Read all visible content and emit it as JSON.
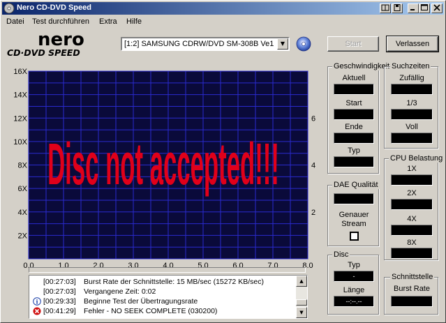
{
  "window": {
    "title": "Nero CD-DVD Speed",
    "controls": [
      "help",
      "save",
      "minimize",
      "maximize",
      "close"
    ]
  },
  "menu": [
    "Datei",
    "Test durchführen",
    "Extra",
    "Hilfe"
  ],
  "logo": {
    "line1": "nero",
    "line2": "CD·DVD SPEED"
  },
  "drive": {
    "selected": "[1:2]  SAMSUNG CDRW/DVD SM-308B Ve1"
  },
  "buttons": {
    "start": "Start",
    "exit": "Verlassen"
  },
  "chart_data": {
    "type": "line",
    "overlay_text": "Disc not accepted!!!",
    "x_ticks": [
      "0.0",
      "1.0",
      "2.0",
      "3.0",
      "4.0",
      "5.0",
      "6.0",
      "7.0",
      "8.0"
    ],
    "y_left_ticks": [
      "2X",
      "4X",
      "6X",
      "8X",
      "10X",
      "12X",
      "14X",
      "16X"
    ],
    "y_right_ticks": [
      "2",
      "4",
      "6"
    ],
    "xlim": [
      0,
      8
    ],
    "ylim_left": [
      0,
      16
    ],
    "ylim_right": [
      0,
      8
    ],
    "grid": true,
    "series": [],
    "colors": {
      "background": "#0a0a3a",
      "grid": "#2a2ad0",
      "overlay": "#e0001a"
    }
  },
  "log": [
    {
      "icon": "none",
      "time": "[00:27:03]",
      "message": "Burst Rate der Schnittstelle: 15 MB/sec (15272 KB/sec)"
    },
    {
      "icon": "none",
      "time": "[00:27:03]",
      "message": "Vergangene Zeit:  0:02"
    },
    {
      "icon": "info-icon",
      "time": "[00:29:33]",
      "message": "Beginne Test der Übertragungsrate"
    },
    {
      "icon": "error-icon",
      "time": "[00:41:29]",
      "message": "Fehler - NO SEEK COMPLETE (030200)"
    }
  ],
  "panels": {
    "speed": {
      "title": "Geschwindigkeit",
      "current": "Aktuell",
      "start": "Start",
      "end": "Ende",
      "type": "Typ"
    },
    "seek": {
      "title": "Suchzeiten",
      "random": "Zufällig",
      "third": "1/3",
      "full": "Voll"
    },
    "cpu": {
      "title": "CPU Belastung",
      "x1": "1X",
      "x2": "2X",
      "x4": "4X",
      "x8": "8X"
    },
    "dae": {
      "title": "DAE Qualität",
      "accurate1": "Genauer",
      "accurate2": "Stream"
    },
    "disc": {
      "title": "Disc",
      "type": "Typ",
      "type_value": "-",
      "length": "Länge",
      "length_value": "--:--.--"
    },
    "interface": {
      "title": "Schnittstelle",
      "burst": "Burst Rate"
    }
  }
}
